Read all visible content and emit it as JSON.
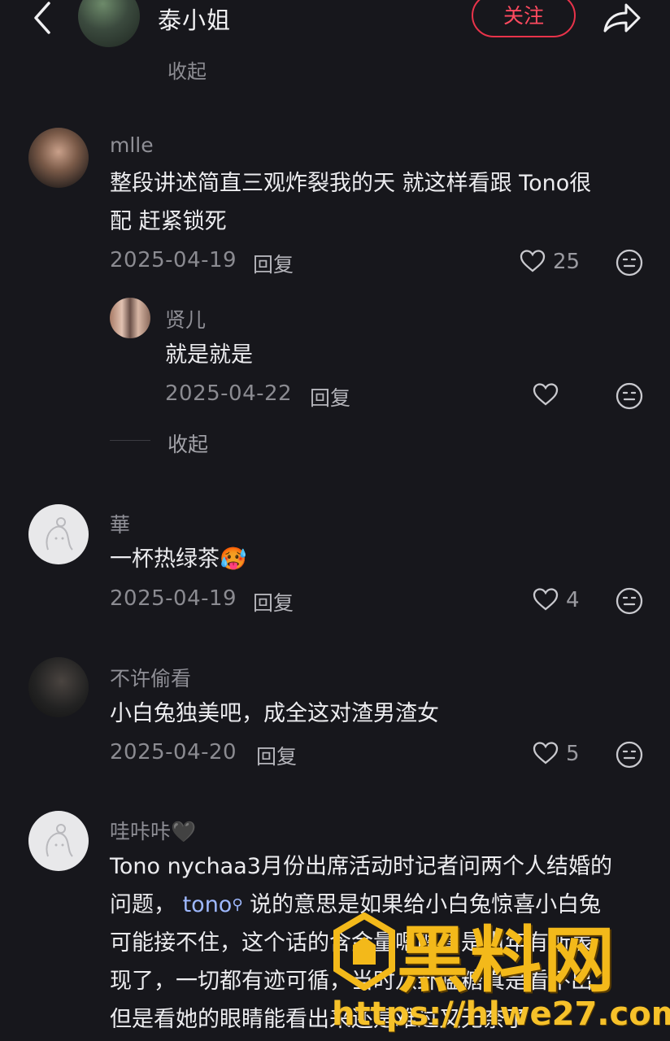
{
  "header": {
    "title": "泰小姐",
    "follow_label": "关注"
  },
  "thread_top": {
    "collapse_label": "收起"
  },
  "comments": [
    {
      "name": "mlle",
      "text_line1": "整段讲述简直三观炸裂我的天 就这样看跟 Tono很",
      "text_line2": "配 赶紧锁死",
      "date": "2025-04-19",
      "reply_label": "回复",
      "likes": "25",
      "replies": [
        {
          "name": "贤儿",
          "text": "就是就是",
          "date": "2025-04-22",
          "reply_label": "回复"
        }
      ],
      "collapse_label": "收起"
    },
    {
      "name": "華",
      "text": "一杯热绿茶",
      "emoji": "🥵",
      "date": "2025-04-19",
      "reply_label": "回复",
      "likes": "4"
    },
    {
      "name": "不许偷看",
      "text": "小白兔独美吧，成全这对渣男渣女",
      "date": "2025-04-20",
      "reply_label": "回复",
      "likes": "5"
    },
    {
      "name": "哇咔咔🖤",
      "lines": [
        "Tono nychaa3月份出席活动时记者问两个人结婚的",
        "说的意思是如果给小白兔惊喜小白兔",
        "可能接不住，这个话的含金量嗯嗯真是当年有所表",
        "现了，一切都有迹可循，当时八卦嗑糖真是看不出",
        "但是看她的眼睛能看出来还是难过又无奈了"
      ],
      "line2_prefix": "问题，",
      "mention": "tono"
    }
  ],
  "watermark": {
    "title": "黑料网",
    "url": "https://hlwe27.com"
  },
  "icons": {
    "back": "chevron-left-icon",
    "share": "share-arrow-icon",
    "like": "heart-outline-icon",
    "dislike": "meh-face-icon",
    "search": "search-icon"
  },
  "colors": {
    "accent": "#e8334a",
    "background": "#17171c",
    "mention": "#9fb9ff"
  }
}
